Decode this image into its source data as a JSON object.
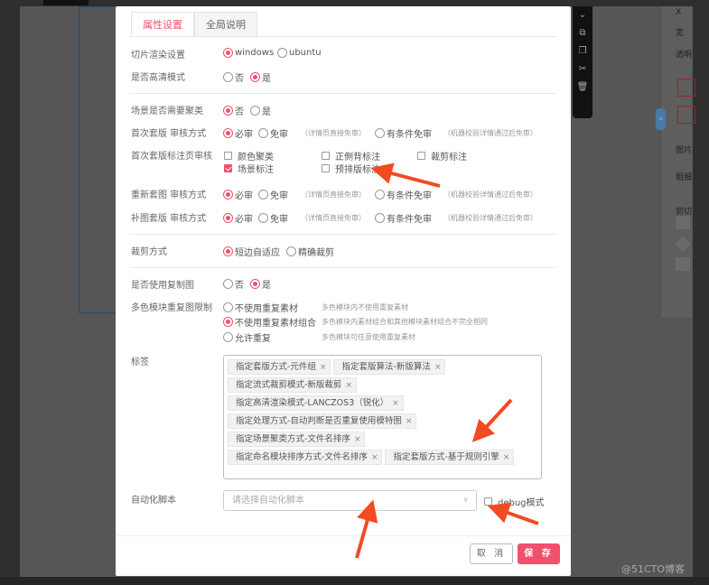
{
  "tabs": [
    {
      "label": "属性设置",
      "active": true
    },
    {
      "label": "全局说明",
      "active": false
    }
  ],
  "toolbar_icons": [
    "chevron-double-down-icon",
    "copy-icon",
    "paste-icon",
    "scissors-icon",
    "trash-icon"
  ],
  "right_panel": {
    "labels": [
      "X",
      "宽",
      "透明",
      "图片",
      "粗细",
      "剪切"
    ]
  },
  "rows": {
    "render": {
      "label": "切片渲染设置",
      "options": [
        "windows",
        "ubuntu"
      ],
      "selected": 0
    },
    "hd": {
      "label": "是否高清模式",
      "options": [
        "否",
        "是"
      ],
      "selected": 1
    },
    "cluster": {
      "label": "场景是否需要聚类",
      "options": [
        "否",
        "是"
      ],
      "selected": 0
    },
    "first_review": {
      "label": "首次套版 审核方式",
      "options": [
        "必审",
        "免审",
        "有条件免审"
      ],
      "hints": [
        "（详情页直接免审）",
        "（机器校验详情通过后免审）"
      ],
      "selected": 0
    },
    "first_mark": {
      "label": "首次套版标注页审核",
      "options": [
        {
          "label": "颜色聚类",
          "checked": false
        },
        {
          "label": "正側背标注",
          "checked": false
        },
        {
          "label": "裁剪标注",
          "checked": false
        },
        {
          "label": "场景标注",
          "checked": true
        },
        {
          "label": "预排版标注",
          "checked": false
        }
      ]
    },
    "re_review": {
      "label": "重新套图 审核方式",
      "options": [
        "必审",
        "免审",
        "有条件免审"
      ],
      "hints": [
        "（详情页直接免审）",
        "（机器校验详情通过后免审）"
      ],
      "selected": 0
    },
    "patch_review": {
      "label": "补图套版 审核方式",
      "options": [
        "必审",
        "免审",
        "有条件免审"
      ],
      "hints": [
        "（详情页直接免审）",
        "（机器校验详情通过后免审）"
      ],
      "selected": 0
    },
    "crop": {
      "label": "裁剪方式",
      "options": [
        "短边自适应",
        "精确裁剪"
      ],
      "selected": 0
    },
    "copy_img": {
      "label": "是否使用复制图",
      "options": [
        "否",
        "是"
      ],
      "selected": 1
    },
    "multi_color": {
      "label": "多色模块重复图限制",
      "options": [
        {
          "label": "不使用重复素材",
          "hint": "多色模块内不使用重复素材"
        },
        {
          "label": "不使用重复素材组合",
          "hint": "多色模块内素材组合和其他模块素材组合不完全相同"
        },
        {
          "label": "允许重复",
          "hint": "多色模块可任意使用重复素材"
        }
      ],
      "selected": 1
    },
    "tags": {
      "label": "标签",
      "items": [
        "指定套版方式-元件组",
        "指定套版算法-新版算法",
        "指定流式裁剪模式-新版裁剪",
        "指定高清渲染模式-LANCZOS3（锐化）",
        "指定处理方式-自动判断是否重复使用模特图",
        "指定场景聚类方式-文件名排序",
        "指定命名模块排序方式-文件名排序",
        "指定套版方式-基于规则引擎"
      ],
      "remove_glyph": "×"
    },
    "script": {
      "label": "自动化脚本",
      "placeholder": "请选择自动化脚本",
      "debug_label": "debug模式",
      "debug_checked": false
    }
  },
  "footer": {
    "cancel": "取 消",
    "save": "保 存"
  },
  "watermark": "@51CTO博客",
  "colors": {
    "accent": "#f0506e",
    "annotation": "#f24a22"
  }
}
